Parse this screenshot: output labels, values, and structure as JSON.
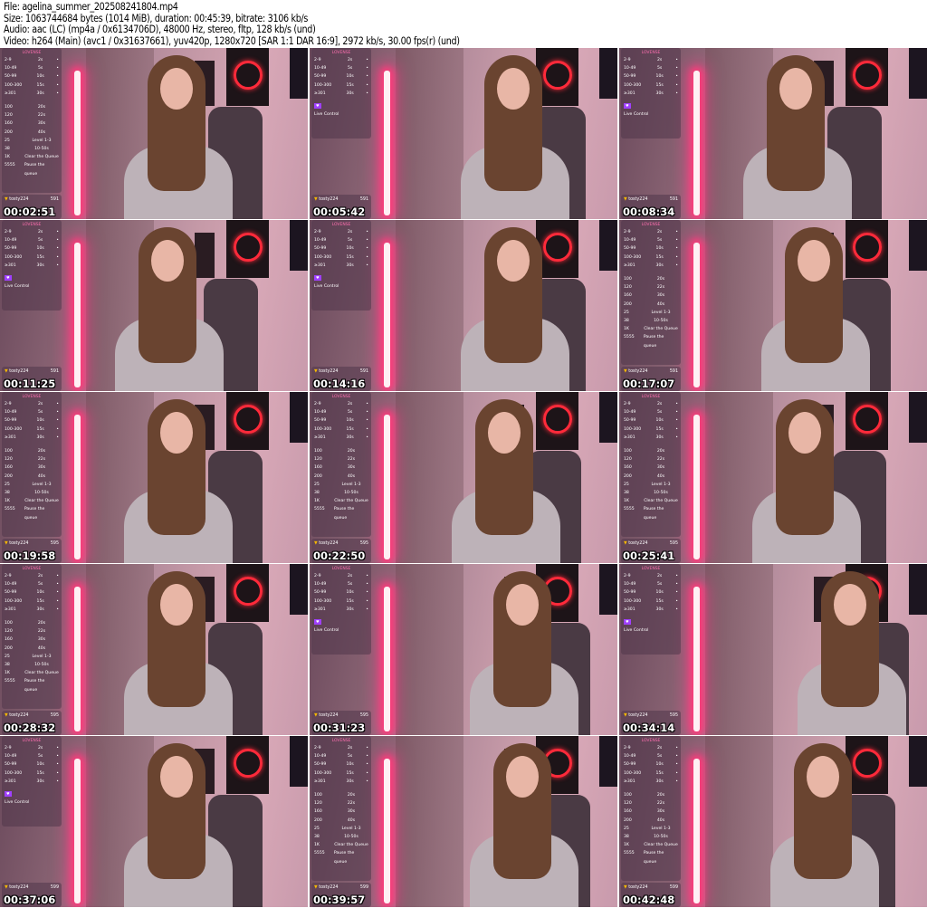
{
  "header": {
    "file": "File: agelina_summer_202508241804.mp4",
    "size": "Size: 1063744684 bytes (1014 MiB), duration: 00:45:39, bitrate: 3106 kb/s",
    "audio": "Audio: aac (LC) (mp4a / 0x6134706D), 48000 Hz, stereo, fltp, 128 kb/s (und)",
    "video": "Video: h264 (Main) (avc1 / 0x31637661), yuv420p, 1280x720 [SAR 1:1 DAR 16:9], 2972 kb/s, 30.00 fps(r) (und)"
  },
  "overlay": {
    "brand": "LOVENSE",
    "top_rows": [
      [
        "2-9",
        "2s"
      ],
      [
        "10-49",
        "5s"
      ],
      [
        "50-99",
        "10s"
      ],
      [
        "100-300",
        "15s"
      ],
      [
        "≥301",
        "30s"
      ]
    ],
    "special_rows": [
      [
        "100",
        "20s"
      ],
      [
        "120",
        "22s"
      ],
      [
        "160",
        "30s"
      ],
      [
        "200",
        "40s"
      ],
      [
        "25",
        "Level 1-3"
      ],
      [
        "38",
        "10-50s"
      ],
      [
        "1K",
        "Clear the Queue"
      ],
      [
        "5555",
        "Pause the queue"
      ]
    ],
    "live_control": "Live Control",
    "tipper": "tosty224"
  },
  "frames": [
    {
      "time": "00:02:51",
      "panel": "full",
      "tip": "591"
    },
    {
      "time": "00:05:42",
      "panel": "short",
      "tip": "591"
    },
    {
      "time": "00:08:34",
      "panel": "short",
      "tip": "591"
    },
    {
      "time": "00:11:25",
      "panel": "short",
      "tip": "591"
    },
    {
      "time": "00:14:16",
      "panel": "short",
      "tip": "591"
    },
    {
      "time": "00:17:07",
      "panel": "full",
      "tip": "591"
    },
    {
      "time": "00:19:58",
      "panel": "full",
      "tip": "595"
    },
    {
      "time": "00:22:50",
      "panel": "full",
      "tip": "595"
    },
    {
      "time": "00:25:41",
      "panel": "full",
      "tip": "595"
    },
    {
      "time": "00:28:32",
      "panel": "full",
      "tip": "595"
    },
    {
      "time": "00:31:23",
      "panel": "short",
      "tip": "595"
    },
    {
      "time": "00:34:14",
      "panel": "short",
      "tip": "595"
    },
    {
      "time": "00:37:06",
      "panel": "short",
      "tip": "599"
    },
    {
      "time": "00:39:57",
      "panel": "full",
      "tip": "599"
    },
    {
      "time": "00:42:48",
      "panel": "full",
      "tip": "599"
    }
  ]
}
